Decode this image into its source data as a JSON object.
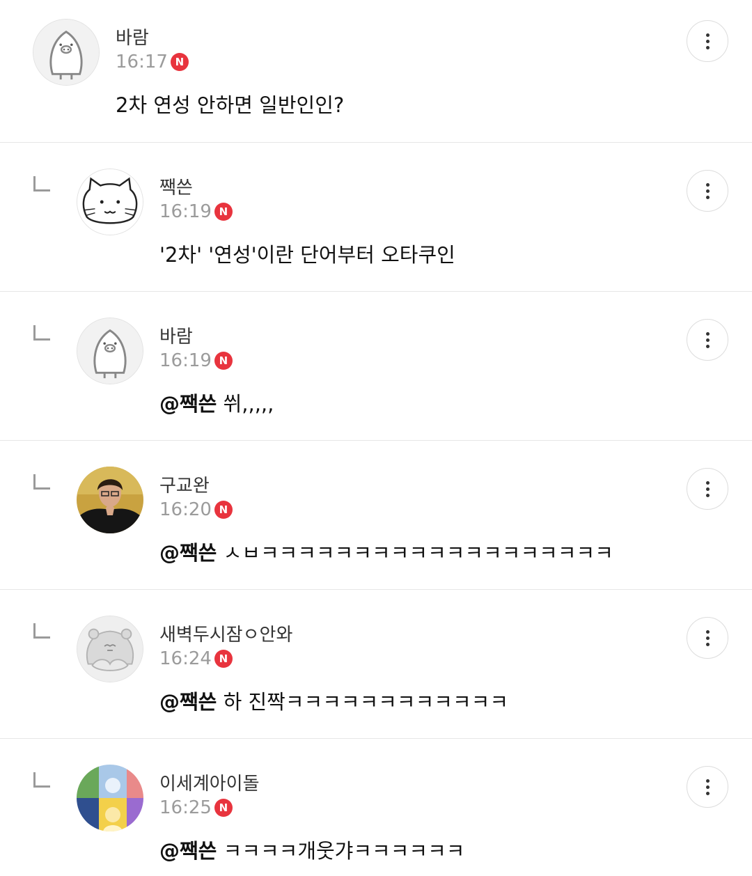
{
  "comments": [
    {
      "name": "바람",
      "time": "16:17",
      "badge": "N",
      "mention": "",
      "text": "2차 연성 안하면 일반인인?",
      "avatar_icon": "penguin-avatar-icon"
    },
    {
      "name": "짹쓴",
      "time": "16:19",
      "badge": "N",
      "mention": "",
      "text": "'2차' '연성'이란 단어부터 오타쿠인",
      "avatar_icon": "cat-avatar-icon"
    },
    {
      "name": "바람",
      "time": "16:19",
      "badge": "N",
      "mention": "@짹쓴",
      "text": " 쒸,,,,,",
      "avatar_icon": "penguin-avatar-icon"
    },
    {
      "name": "구교완",
      "time": "16:20",
      "badge": "N",
      "mention": "@짹쓴",
      "text": " ㅅㅂㅋㅋㅋㅋㅋㅋㅋㅋㅋㅋㅋㅋㅋㅋㅋㅋㅋㅋㅋ",
      "avatar_icon": "person-photo-avatar"
    },
    {
      "name": "새벽두시잠ㅇ안와",
      "time": "16:24",
      "badge": "N",
      "mention": "@짹쓴",
      "text": " 하 진짝ㅋㅋㅋㅋㅋㅋㅋㅋㅋㅋㅋㅋ",
      "avatar_icon": "hamster-avatar-icon"
    },
    {
      "name": "이세계아이돌",
      "time": "16:25",
      "badge": "N",
      "mention": "@짹쓴",
      "text": " ㅋㅋㅋㅋ개웃갸ㅋㅋㅋㅋㅋㅋ",
      "avatar_icon": "group-avatar-icon"
    }
  ],
  "colors": {
    "badge": "#e8343e",
    "time": "#9b9b9b",
    "divider": "#e6e6e6"
  }
}
